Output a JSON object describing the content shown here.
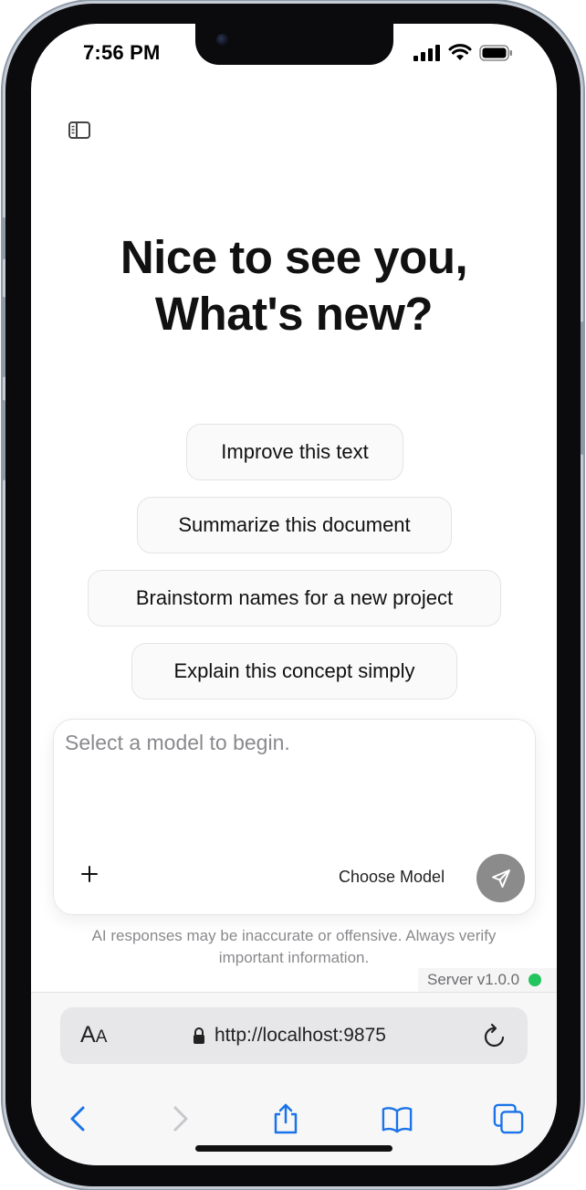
{
  "status_bar": {
    "time": "7:56 PM"
  },
  "hero": {
    "line1": "Nice to see you,",
    "line2": "What's new?"
  },
  "suggestions": [
    {
      "label": "Improve this text"
    },
    {
      "label": "Summarize this document"
    },
    {
      "label": "Brainstorm names for a new project"
    },
    {
      "label": "Explain this concept simply"
    }
  ],
  "composer": {
    "placeholder": "Select a model to begin.",
    "model_label": "Choose Model"
  },
  "disclaimer": "AI responses may be inaccurate or offensive. Always verify important information.",
  "server": {
    "version": "Server v1.0.0",
    "status_color": "#22c55e"
  },
  "browser": {
    "aa_big": "A",
    "aa_small": "A",
    "url": "http://localhost:9875"
  }
}
